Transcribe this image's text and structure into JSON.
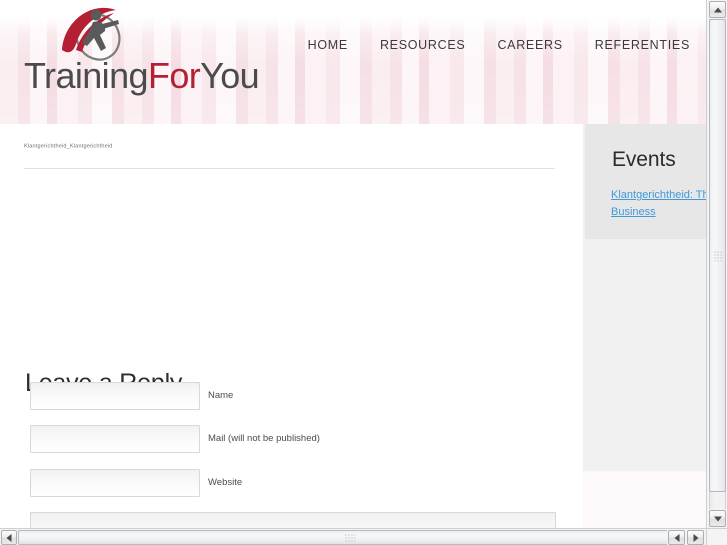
{
  "site": {
    "logo_text_part1": "Training",
    "logo_text_part2": "For",
    "logo_text_part3": "You",
    "logo_icon": "running-person-swoosh-logo"
  },
  "nav": {
    "items": [
      {
        "label": "HOME"
      },
      {
        "label": "RESOURCES"
      },
      {
        "label": "CAREERS"
      },
      {
        "label": "REFERENTIES"
      }
    ]
  },
  "content": {
    "breadcrumb": "Klantgerichtheid_Klantgerichtheid",
    "reply_heading": "Leave a Reply",
    "fields": [
      {
        "label": "Name",
        "value": "",
        "placeholder": ""
      },
      {
        "label": "Mail (will not be published)",
        "value": "",
        "placeholder": ""
      },
      {
        "label": "Website",
        "value": "",
        "placeholder": ""
      }
    ],
    "comment": {
      "value": "",
      "placeholder": ""
    }
  },
  "sidebar": {
    "events_title": "Events",
    "events_links": [
      {
        "label": "Klantgerichtheid: The Business"
      }
    ]
  },
  "colors": {
    "brand_red": "#b51f34",
    "logo_dark": "#4b4b4b",
    "link_blue": "#3f9ad6",
    "header_pink": "#fbf0f3"
  },
  "scrollbars": {
    "vertical_up_icon": "scroll-up-arrow-icon",
    "vertical_down_icon": "scroll-down-arrow-icon",
    "horizontal_left_icon": "scroll-left-arrow-icon",
    "horizontal_right_icon": "scroll-right-arrow-icon"
  }
}
